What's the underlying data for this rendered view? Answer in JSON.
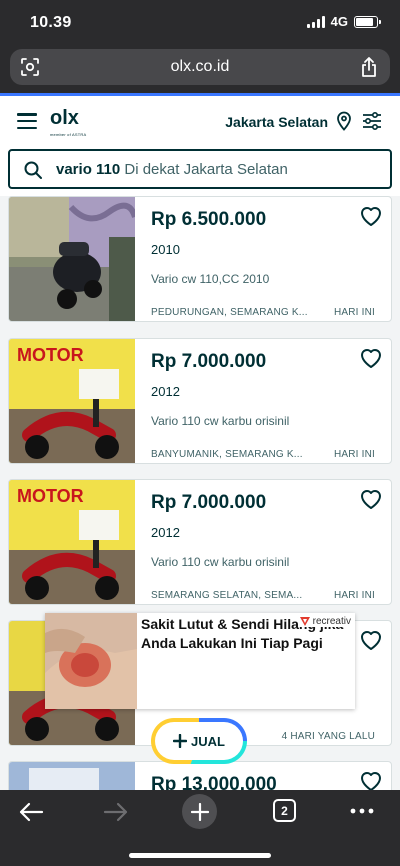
{
  "status_bar": {
    "time": "10.39",
    "network": "4G",
    "battery_level": 0.85
  },
  "browser": {
    "url": "olx.co.id",
    "tab_count": "2"
  },
  "header": {
    "logo_text": "olx",
    "logo_subtext": "member of ASTRA",
    "location": "Jakarta Selatan"
  },
  "search": {
    "query": "vario 110",
    "suffix": " Di dekat Jakarta Selatan"
  },
  "listings": [
    {
      "price": "Rp 6.500.000",
      "year": "2010",
      "title": "Vario cw 110,CC 2010",
      "location": "PEDURUNGAN, SEMARANG K...",
      "date": "HARI INI"
    },
    {
      "price": "Rp 7.000.000",
      "year": "2012",
      "title": "Vario 110 cw karbu orisinil",
      "location": "BANYUMANIK, SEMARANG K...",
      "date": "HARI INI"
    },
    {
      "price": "Rp 7.000.000",
      "year": "2012",
      "title": "Vario 110 cw karbu orisinil",
      "location": "SEMARANG SELATAN, SEMA...",
      "date": "HARI INI"
    },
    {
      "price": "",
      "year": "",
      "title": "",
      "location": "",
      "date": "4 HARI YANG LALU"
    },
    {
      "price": "Rp 13.000.000",
      "year": "",
      "title": "",
      "location": "",
      "date": ""
    }
  ],
  "thumb_banner": "MOTOR",
  "ad": {
    "text": "Sakit Lutut & Sendi Hilang jika Anda Lakukan Ini Tiap Pagi",
    "brand": "recreativ"
  },
  "sell_button": {
    "label": "JUAL"
  },
  "colors": {
    "primary": "#002f34",
    "chrome": "#2b2b2d",
    "accent_blue": "#3a77ff",
    "accent_teal": "#23e5db",
    "accent_yellow": "#ffce32"
  }
}
